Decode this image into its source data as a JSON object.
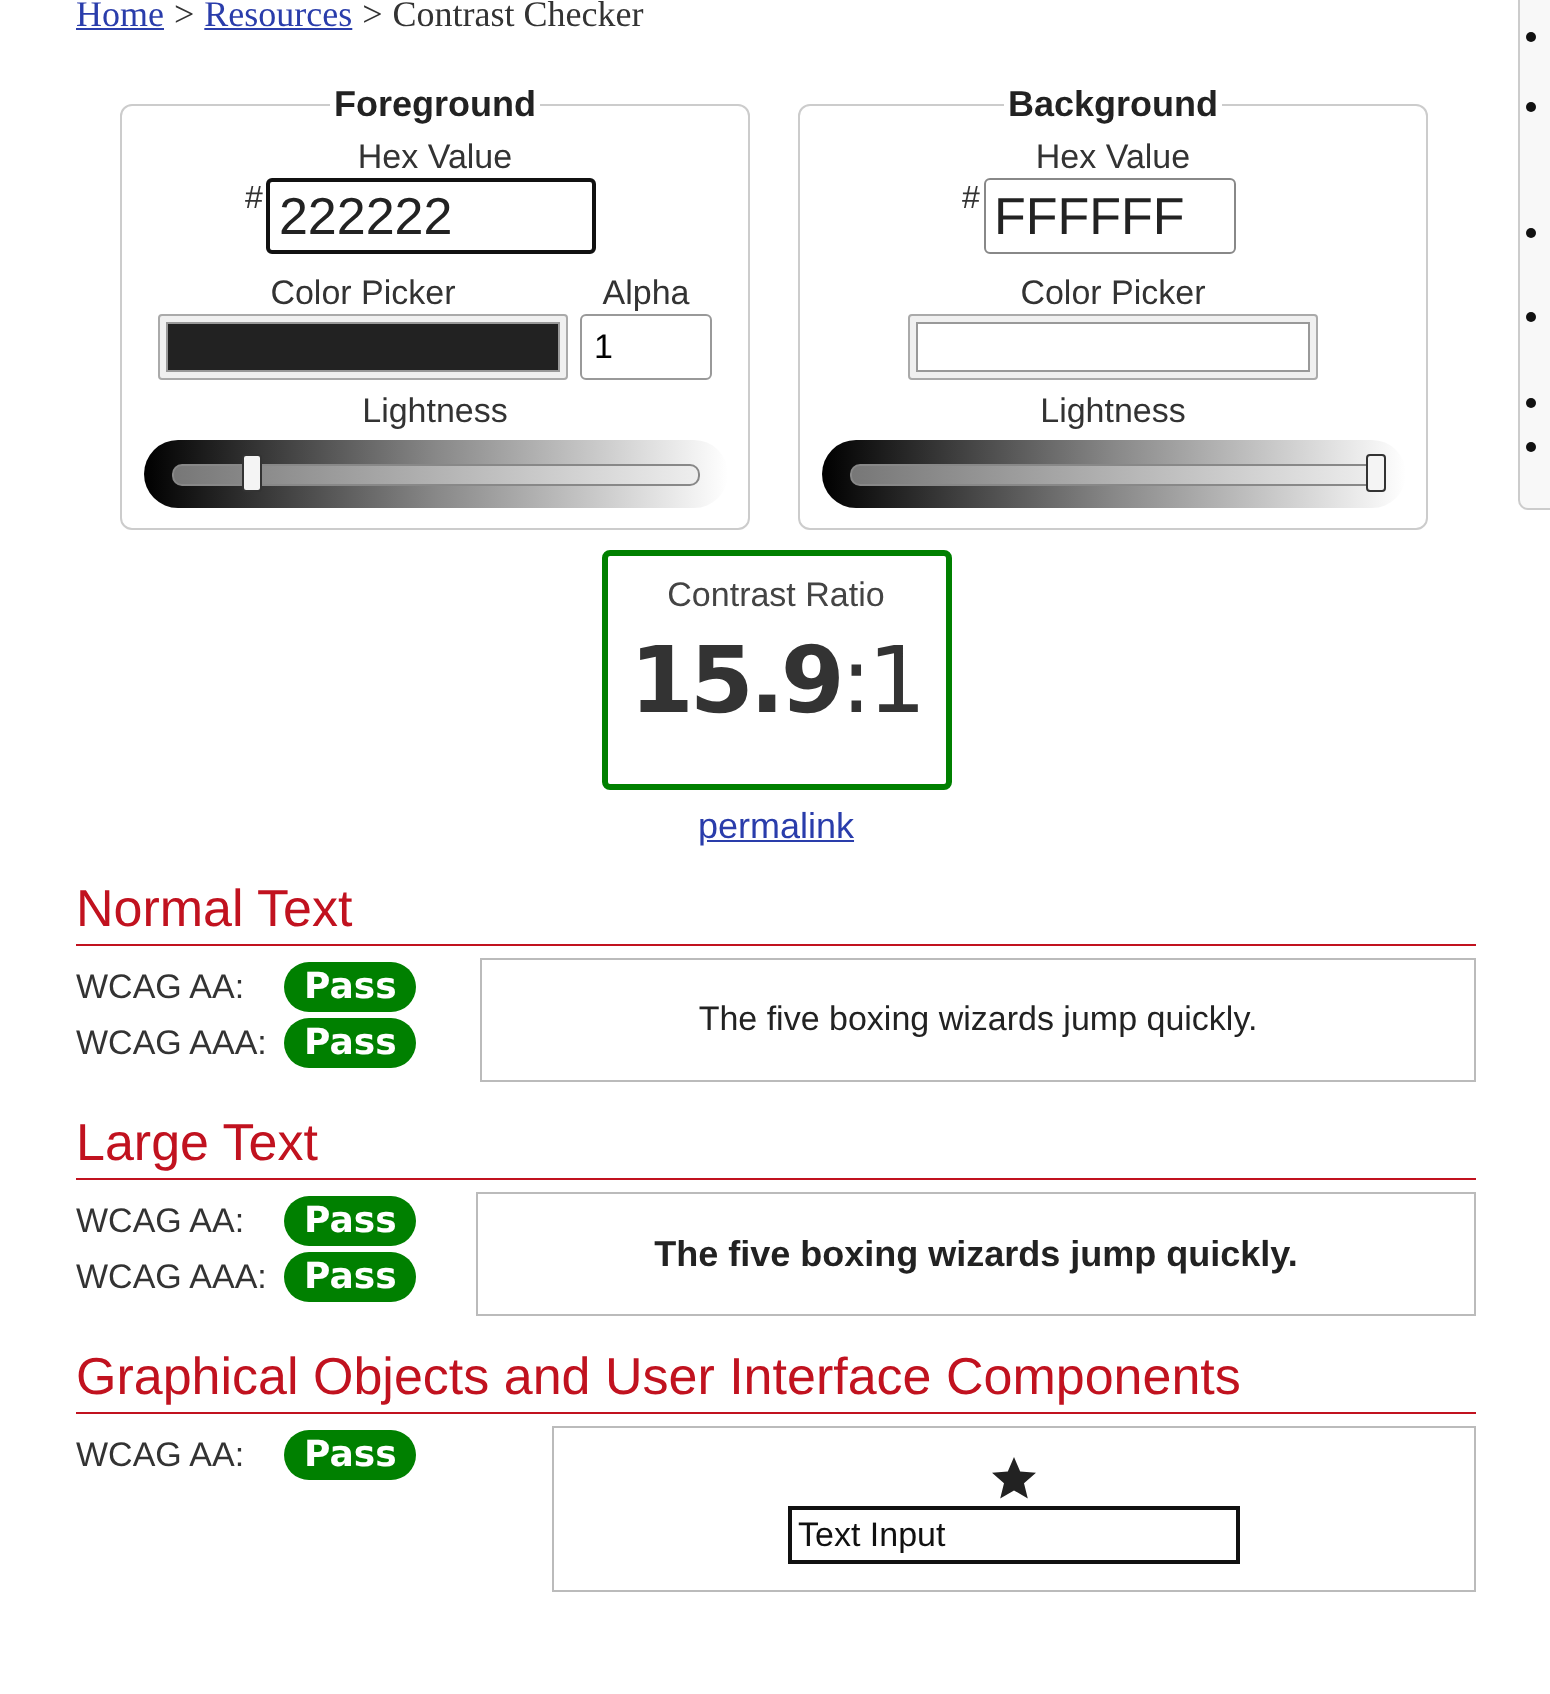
{
  "breadcrumb": [
    {
      "kind": "link",
      "text": "Home"
    },
    {
      "kind": "separator",
      "text": ">"
    },
    {
      "kind": "link",
      "text": "Resources"
    },
    {
      "kind": "separator",
      "text": ">"
    },
    {
      "kind": "current",
      "text": "Contrast Checker"
    }
  ],
  "panels": [
    {
      "title": "Foreground",
      "hex_label": "Hex Value",
      "hash": "#",
      "hex_value": "222222",
      "focused": true,
      "picker_label": "Color Picker",
      "color": "#222222",
      "alpha_label": "Alpha",
      "alpha_value": "1",
      "lightness_label": "Lightness",
      "level": 0.15
    },
    {
      "title": "Background",
      "hex_label": "Hex Value",
      "hash": "#",
      "hex_value": "FFFFFF",
      "focused": false,
      "picker_label": "Color Picker",
      "color": "#ffffff",
      "lightness_label": "Lightness",
      "level": 1
    }
  ],
  "contrast": {
    "label": "Contrast Ratio",
    "ratio": "**15.9**:1",
    "link": "permalink",
    "passed": true
  },
  "sections": [
    {
      "kind": "normal",
      "title": "Normal Text",
      "results": [
        {
          "label": "WCAG AA:",
          "result": "Pass",
          "passed": true
        },
        {
          "label": "WCAG AAA:",
          "result": "Pass",
          "passed": true
        }
      ],
      "sample": "The five boxing wizards jump quickly."
    },
    {
      "kind": "large",
      "title": "Large Text",
      "results": [
        {
          "label": "WCAG AA:",
          "result": "Pass",
          "passed": true
        },
        {
          "label": "WCAG AAA:",
          "result": "Pass",
          "passed": true
        }
      ],
      "sample": "The five boxing wizards jump quickly."
    },
    {
      "kind": "graphics",
      "title": "Graphical Objects and User Interface Components",
      "results": [
        {
          "label": "WCAG AA:",
          "result": "Pass",
          "passed": true
        }
      ],
      "sample_input": "Text Input"
    }
  ]
}
